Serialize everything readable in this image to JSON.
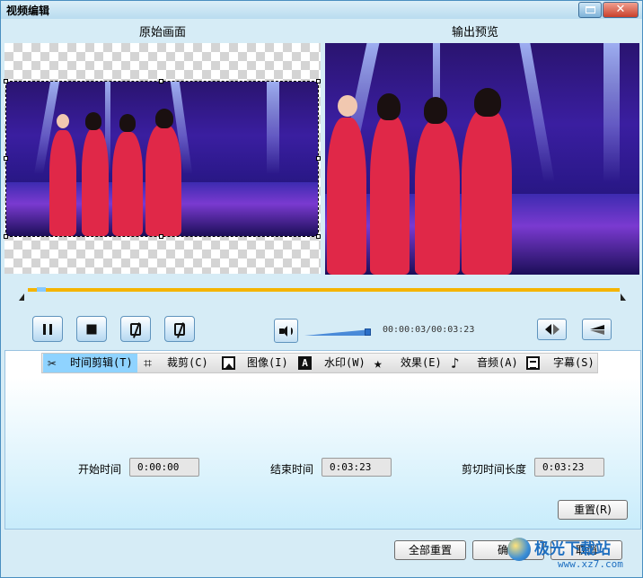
{
  "window": {
    "title": "视频编辑",
    "close_glyph": "✕"
  },
  "preview": {
    "original_label": "原始画面",
    "output_label": "输出预览"
  },
  "playback": {
    "time": "00:00:03/00:03:23",
    "volume_level": 0.95,
    "progress_fraction": 0.015
  },
  "tabs": [
    {
      "label": "时间剪辑(T)",
      "icon": "scissors-icon",
      "active": true
    },
    {
      "label": "裁剪(C)",
      "icon": "crop-icon",
      "active": false
    },
    {
      "label": "图像(I)",
      "icon": "image-icon",
      "active": false
    },
    {
      "label": "水印(W)",
      "icon": "watermark-icon",
      "icon_text": "A",
      "active": false
    },
    {
      "label": "效果(E)",
      "icon": "star-icon",
      "active": false
    },
    {
      "label": "音频(A)",
      "icon": "music-note-icon",
      "active": false
    },
    {
      "label": "字幕(S)",
      "icon": "subtitle-icon",
      "active": false
    }
  ],
  "trim": {
    "start_label": "开始时间",
    "start_value": "0:00:00",
    "end_label": "结束时间",
    "end_value": "0:03:23",
    "duration_label": "剪切时间长度",
    "duration_value": "0:03:23",
    "reset_label": "重置(R)"
  },
  "footer": {
    "reset_all_label": "全部重置",
    "ok_label": "确定",
    "cancel_label": "取消"
  },
  "site_watermark": {
    "name": "极光下载站",
    "url": "www.xz7.com"
  },
  "colors": {
    "window_bg": "#d6ecf6",
    "timeline": "#f5b400",
    "active_tab": "#8fd3ff",
    "costume": "#e02848"
  }
}
